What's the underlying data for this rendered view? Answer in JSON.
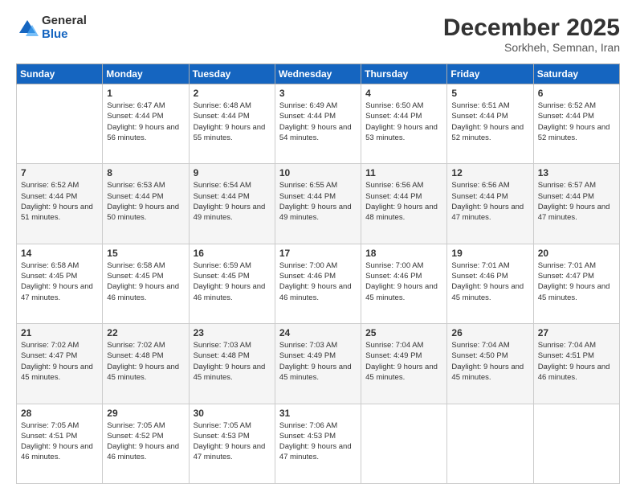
{
  "logo": {
    "general": "General",
    "blue": "Blue"
  },
  "header": {
    "month": "December 2025",
    "location": "Sorkheh, Semnan, Iran"
  },
  "weekdays": [
    "Sunday",
    "Monday",
    "Tuesday",
    "Wednesday",
    "Thursday",
    "Friday",
    "Saturday"
  ],
  "weeks": [
    [
      {
        "day": "",
        "sunrise": "",
        "sunset": "",
        "daylight": ""
      },
      {
        "day": "1",
        "sunrise": "Sunrise: 6:47 AM",
        "sunset": "Sunset: 4:44 PM",
        "daylight": "Daylight: 9 hours and 56 minutes."
      },
      {
        "day": "2",
        "sunrise": "Sunrise: 6:48 AM",
        "sunset": "Sunset: 4:44 PM",
        "daylight": "Daylight: 9 hours and 55 minutes."
      },
      {
        "day": "3",
        "sunrise": "Sunrise: 6:49 AM",
        "sunset": "Sunset: 4:44 PM",
        "daylight": "Daylight: 9 hours and 54 minutes."
      },
      {
        "day": "4",
        "sunrise": "Sunrise: 6:50 AM",
        "sunset": "Sunset: 4:44 PM",
        "daylight": "Daylight: 9 hours and 53 minutes."
      },
      {
        "day": "5",
        "sunrise": "Sunrise: 6:51 AM",
        "sunset": "Sunset: 4:44 PM",
        "daylight": "Daylight: 9 hours and 52 minutes."
      },
      {
        "day": "6",
        "sunrise": "Sunrise: 6:52 AM",
        "sunset": "Sunset: 4:44 PM",
        "daylight": "Daylight: 9 hours and 52 minutes."
      }
    ],
    [
      {
        "day": "7",
        "sunrise": "Sunrise: 6:52 AM",
        "sunset": "Sunset: 4:44 PM",
        "daylight": "Daylight: 9 hours and 51 minutes."
      },
      {
        "day": "8",
        "sunrise": "Sunrise: 6:53 AM",
        "sunset": "Sunset: 4:44 PM",
        "daylight": "Daylight: 9 hours and 50 minutes."
      },
      {
        "day": "9",
        "sunrise": "Sunrise: 6:54 AM",
        "sunset": "Sunset: 4:44 PM",
        "daylight": "Daylight: 9 hours and 49 minutes."
      },
      {
        "day": "10",
        "sunrise": "Sunrise: 6:55 AM",
        "sunset": "Sunset: 4:44 PM",
        "daylight": "Daylight: 9 hours and 49 minutes."
      },
      {
        "day": "11",
        "sunrise": "Sunrise: 6:56 AM",
        "sunset": "Sunset: 4:44 PM",
        "daylight": "Daylight: 9 hours and 48 minutes."
      },
      {
        "day": "12",
        "sunrise": "Sunrise: 6:56 AM",
        "sunset": "Sunset: 4:44 PM",
        "daylight": "Daylight: 9 hours and 47 minutes."
      },
      {
        "day": "13",
        "sunrise": "Sunrise: 6:57 AM",
        "sunset": "Sunset: 4:44 PM",
        "daylight": "Daylight: 9 hours and 47 minutes."
      }
    ],
    [
      {
        "day": "14",
        "sunrise": "Sunrise: 6:58 AM",
        "sunset": "Sunset: 4:45 PM",
        "daylight": "Daylight: 9 hours and 47 minutes."
      },
      {
        "day": "15",
        "sunrise": "Sunrise: 6:58 AM",
        "sunset": "Sunset: 4:45 PM",
        "daylight": "Daylight: 9 hours and 46 minutes."
      },
      {
        "day": "16",
        "sunrise": "Sunrise: 6:59 AM",
        "sunset": "Sunset: 4:45 PM",
        "daylight": "Daylight: 9 hours and 46 minutes."
      },
      {
        "day": "17",
        "sunrise": "Sunrise: 7:00 AM",
        "sunset": "Sunset: 4:46 PM",
        "daylight": "Daylight: 9 hours and 46 minutes."
      },
      {
        "day": "18",
        "sunrise": "Sunrise: 7:00 AM",
        "sunset": "Sunset: 4:46 PM",
        "daylight": "Daylight: 9 hours and 45 minutes."
      },
      {
        "day": "19",
        "sunrise": "Sunrise: 7:01 AM",
        "sunset": "Sunset: 4:46 PM",
        "daylight": "Daylight: 9 hours and 45 minutes."
      },
      {
        "day": "20",
        "sunrise": "Sunrise: 7:01 AM",
        "sunset": "Sunset: 4:47 PM",
        "daylight": "Daylight: 9 hours and 45 minutes."
      }
    ],
    [
      {
        "day": "21",
        "sunrise": "Sunrise: 7:02 AM",
        "sunset": "Sunset: 4:47 PM",
        "daylight": "Daylight: 9 hours and 45 minutes."
      },
      {
        "day": "22",
        "sunrise": "Sunrise: 7:02 AM",
        "sunset": "Sunset: 4:48 PM",
        "daylight": "Daylight: 9 hours and 45 minutes."
      },
      {
        "day": "23",
        "sunrise": "Sunrise: 7:03 AM",
        "sunset": "Sunset: 4:48 PM",
        "daylight": "Daylight: 9 hours and 45 minutes."
      },
      {
        "day": "24",
        "sunrise": "Sunrise: 7:03 AM",
        "sunset": "Sunset: 4:49 PM",
        "daylight": "Daylight: 9 hours and 45 minutes."
      },
      {
        "day": "25",
        "sunrise": "Sunrise: 7:04 AM",
        "sunset": "Sunset: 4:49 PM",
        "daylight": "Daylight: 9 hours and 45 minutes."
      },
      {
        "day": "26",
        "sunrise": "Sunrise: 7:04 AM",
        "sunset": "Sunset: 4:50 PM",
        "daylight": "Daylight: 9 hours and 45 minutes."
      },
      {
        "day": "27",
        "sunrise": "Sunrise: 7:04 AM",
        "sunset": "Sunset: 4:51 PM",
        "daylight": "Daylight: 9 hours and 46 minutes."
      }
    ],
    [
      {
        "day": "28",
        "sunrise": "Sunrise: 7:05 AM",
        "sunset": "Sunset: 4:51 PM",
        "daylight": "Daylight: 9 hours and 46 minutes."
      },
      {
        "day": "29",
        "sunrise": "Sunrise: 7:05 AM",
        "sunset": "Sunset: 4:52 PM",
        "daylight": "Daylight: 9 hours and 46 minutes."
      },
      {
        "day": "30",
        "sunrise": "Sunrise: 7:05 AM",
        "sunset": "Sunset: 4:53 PM",
        "daylight": "Daylight: 9 hours and 47 minutes."
      },
      {
        "day": "31",
        "sunrise": "Sunrise: 7:06 AM",
        "sunset": "Sunset: 4:53 PM",
        "daylight": "Daylight: 9 hours and 47 minutes."
      },
      {
        "day": "",
        "sunrise": "",
        "sunset": "",
        "daylight": ""
      },
      {
        "day": "",
        "sunrise": "",
        "sunset": "",
        "daylight": ""
      },
      {
        "day": "",
        "sunrise": "",
        "sunset": "",
        "daylight": ""
      }
    ]
  ]
}
